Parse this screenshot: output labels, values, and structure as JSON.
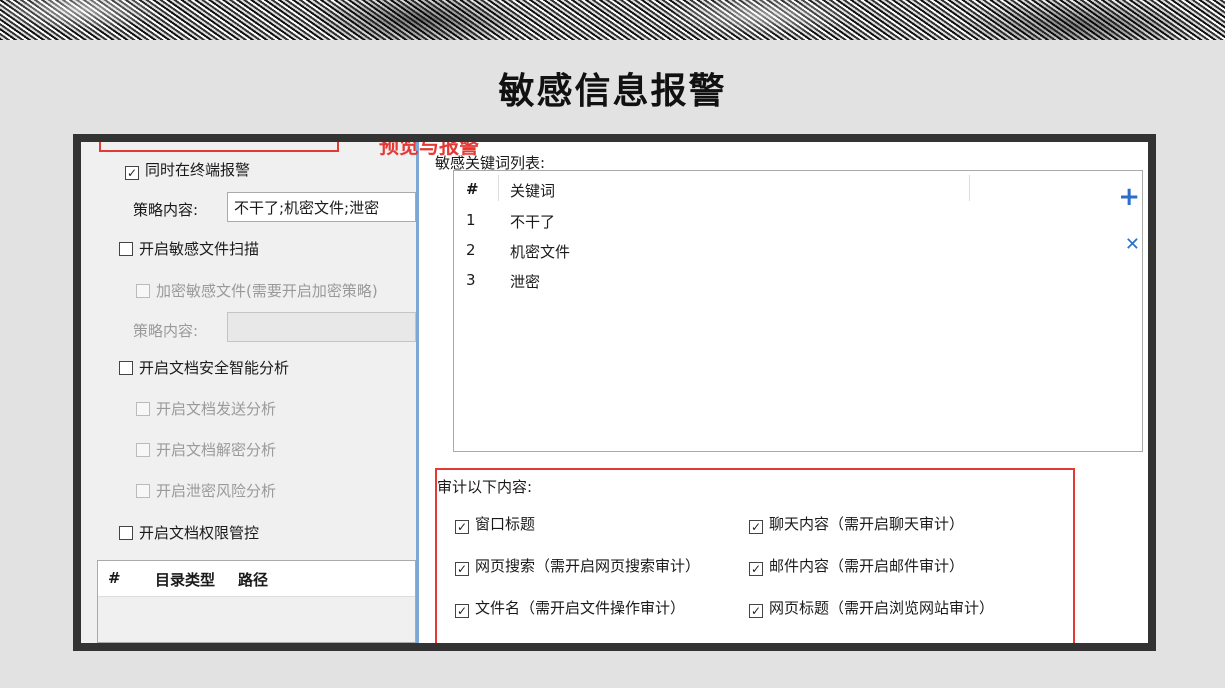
{
  "slide_title": "敏感信息报警",
  "left": {
    "sync_alarm": "同时在终端报警",
    "policy_label_1": "策略内容:",
    "policy_value_1": "不干了;机密文件;泄密",
    "sensitive_scan": "开启敏感文件扫描",
    "encrypt_sensitive": "加密敏感文件(需要开启加密策略)",
    "policy_label_2": "策略内容:",
    "policy_value_2": "",
    "doc_security": "开启文档安全智能分析",
    "doc_send": "开启文档发送分析",
    "doc_decrypt": "开启文档解密分析",
    "leak_risk": "开启泄密风险分析",
    "doc_permission": "开启文档权限管控",
    "dir_table": {
      "col_num": "#",
      "col_type": "目录类型",
      "col_path": "路径"
    }
  },
  "right": {
    "partial_label": "预览与报警",
    "keyword_list_label": "敏感关键词列表:",
    "keyword_table": {
      "col_num": "#",
      "col_keyword": "关键词",
      "rows": [
        {
          "num": "1",
          "keyword": "不干了"
        },
        {
          "num": "2",
          "keyword": "机密文件"
        },
        {
          "num": "3",
          "keyword": "泄密"
        }
      ]
    },
    "audit_label": "审计以下内容:",
    "audit_items": [
      "窗口标题",
      "聊天内容（需开启聊天审计）",
      "网页搜索（需开启网页搜索审计）",
      "邮件内容（需开启邮件审计）",
      "文件名（需开启文件操作审计）",
      "网页标题（需开启浏览网站审计）"
    ],
    "side_glyph_1": "+",
    "side_glyph_2": "✕"
  },
  "colors": {
    "highlight": "#e53935",
    "divider": "#7ca7d6",
    "frame": "#333333"
  }
}
